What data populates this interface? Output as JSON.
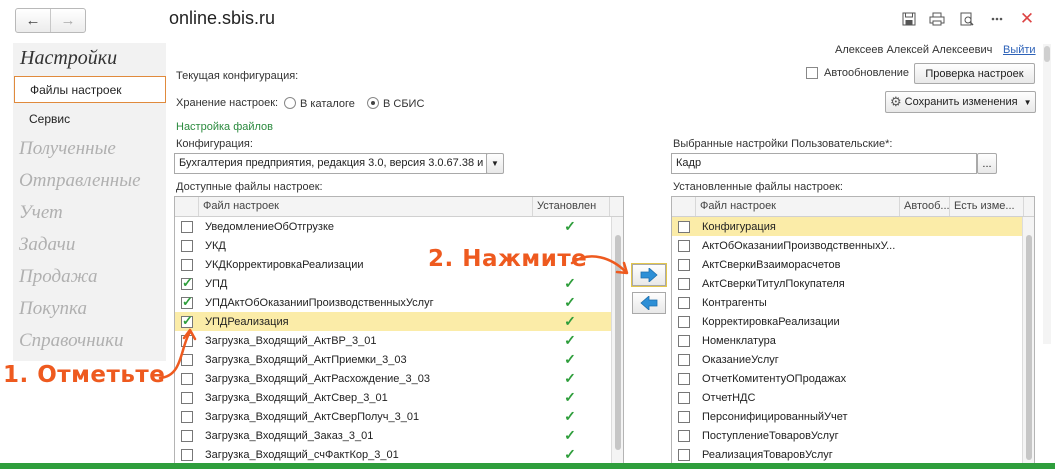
{
  "window": {
    "title": "online.sbis.ru",
    "nav_back": "←",
    "nav_forward": "→"
  },
  "user": {
    "name": "Алексеев Алексей Алексеевич",
    "logout": "Выйти"
  },
  "sidebar": {
    "heading": "Настройки",
    "items": [
      "Файлы настроек",
      "Сервис"
    ],
    "sections": [
      "Полученные",
      "Отправленные",
      "Учет",
      "Задачи",
      "Продажа",
      "Покупка",
      "Справочники"
    ]
  },
  "form": {
    "current_config_label": "Текущая конфигурация:",
    "auto_update_label": "Автообновление",
    "check_settings_button": "Проверка настроек",
    "save_changes_button": "Сохранить изменения",
    "storage_label": "Хранение настроек:",
    "storage_options": [
      "В каталоге",
      "В СБИС"
    ],
    "storage_selected": "В СБИС",
    "files_section": "Настройка файлов",
    "config_label": "Конфигурация:",
    "config_value": "Бухгалтерия предприятия, редакция 3.0, версия 3.0.67.38 и",
    "user_settings_label": "Выбранные настройки Пользовательские*:",
    "user_settings_value": "Кадр",
    "browse_button": "...",
    "available_label": "Доступные файлы настроек:",
    "installed_label": "Установленные файлы настроек:"
  },
  "available_table": {
    "columns": [
      "Файл настроек",
      "Установлен"
    ],
    "rows": [
      {
        "name": "УведомлениеОбОтгрузке",
        "checked": false,
        "installed": true
      },
      {
        "name": "УКД",
        "checked": false,
        "installed": false
      },
      {
        "name": "УКДКорректировкаРеализации",
        "checked": false,
        "installed": false
      },
      {
        "name": "УПД",
        "checked": true,
        "installed": true
      },
      {
        "name": "УПДАктОбОказанииПроизводственныхУслуг",
        "checked": true,
        "installed": true
      },
      {
        "name": "УПДРеализация",
        "checked": true,
        "installed": true,
        "highlighted": true
      },
      {
        "name": "Загрузка_Входящий_АктВР_3_01",
        "checked": false,
        "installed": true
      },
      {
        "name": "Загрузка_Входящий_АктПриемки_3_03",
        "checked": false,
        "installed": true
      },
      {
        "name": "Загрузка_Входящий_АктРасхождение_3_03",
        "checked": false,
        "installed": true
      },
      {
        "name": "Загрузка_Входящий_АктСвер_3_01",
        "checked": false,
        "installed": true
      },
      {
        "name": "Загрузка_Входящий_АктСверПолуч_3_01",
        "checked": false,
        "installed": true
      },
      {
        "name": "Загрузка_Входящий_Заказ_3_01",
        "checked": false,
        "installed": true
      },
      {
        "name": "Загрузка_Входящий_счФактКор_3_01",
        "checked": false,
        "installed": true
      }
    ]
  },
  "installed_table": {
    "columns": [
      "Файл настроек",
      "Автооб...",
      "Есть изме..."
    ],
    "rows": [
      {
        "name": "Конфигурация",
        "highlighted": true
      },
      {
        "name": "АктОбОказанииПроизводственныхУ..."
      },
      {
        "name": "АктСверкиВзаиморасчетов"
      },
      {
        "name": "АктСверкиТитулПокупателя"
      },
      {
        "name": "Контрагенты"
      },
      {
        "name": "КорректировкаРеализации"
      },
      {
        "name": "Номенклатура"
      },
      {
        "name": "ОказаниеУслуг"
      },
      {
        "name": "ОтчетКомитентуОПродажах"
      },
      {
        "name": "ОтчетНДС"
      },
      {
        "name": "ПерсонифицированныйУчет"
      },
      {
        "name": "ПоступлениеТоваровУслуг"
      },
      {
        "name": "РеализацияТоваровУслуг"
      }
    ]
  },
  "annotations": {
    "step1": "1. Отметьте",
    "step2": "2. Нажмите"
  },
  "colors": {
    "accent": "#e08a3c",
    "annotation": "#ee5a1f",
    "tick": "#2f9e3c",
    "highlight": "#fbeca8",
    "arrow": "#2d8fd6"
  }
}
